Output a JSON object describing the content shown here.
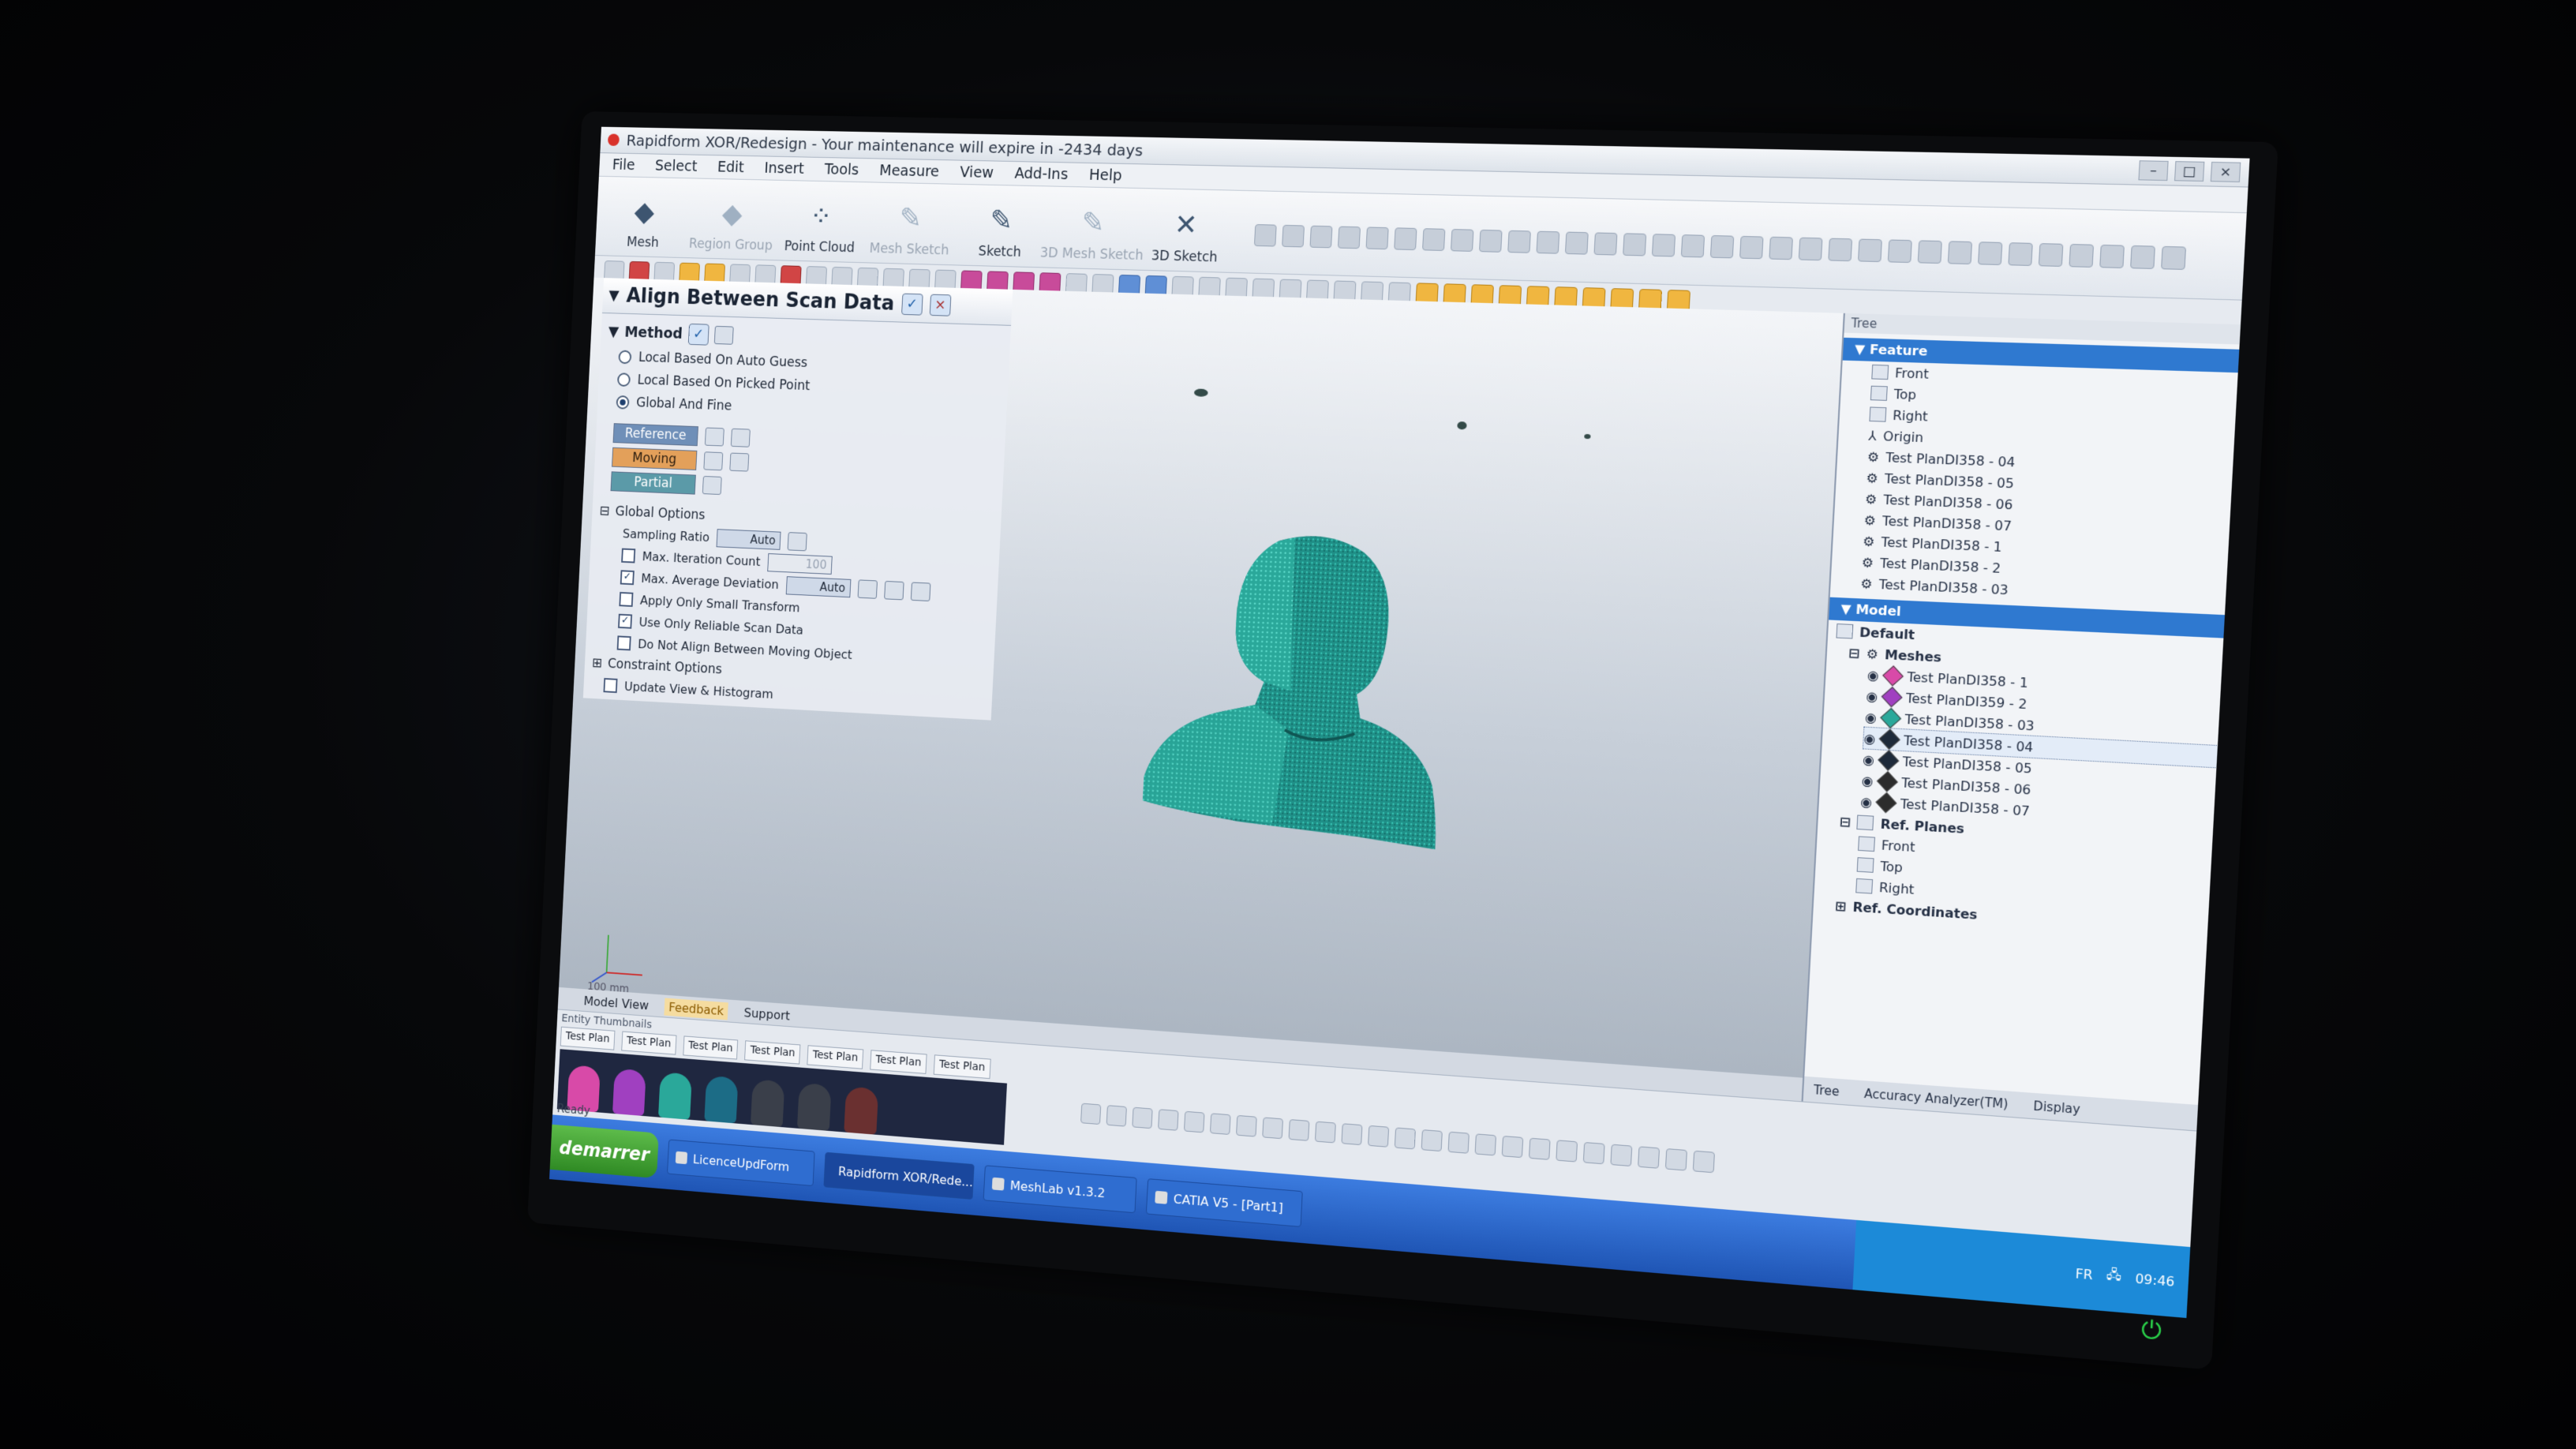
{
  "window": {
    "title": "Rapidform XOR/Redesign - Your maintenance will expire in -2434 days"
  },
  "menu": [
    "File",
    "Select",
    "Edit",
    "Insert",
    "Tools",
    "Measure",
    "View",
    "Add-Ins",
    "Help"
  ],
  "ribbon": [
    {
      "label": "Mesh",
      "icon": "mesh-icon",
      "dim": false
    },
    {
      "label": "Region Group",
      "icon": "region-group-icon",
      "dim": true
    },
    {
      "label": "Point Cloud",
      "icon": "point-cloud-icon",
      "dim": false
    },
    {
      "label": "Mesh Sketch",
      "icon": "mesh-sketch-icon",
      "dim": true
    },
    {
      "label": "Sketch",
      "icon": "sketch-icon",
      "dim": false
    },
    {
      "label": "3D Mesh Sketch",
      "icon": "3d-mesh-sketch-icon",
      "dim": true
    },
    {
      "label": "3D Sketch",
      "icon": "3d-sketch-icon",
      "dim": false
    }
  ],
  "panel": {
    "title": "Align Between Scan Data",
    "method_label": "Method",
    "methods": [
      {
        "label": "Local Based On Auto Guess",
        "selected": false
      },
      {
        "label": "Local Based On Picked Point",
        "selected": false
      },
      {
        "label": "Global And Fine",
        "selected": true
      }
    ],
    "roles": {
      "reference": "Reference",
      "moving": "Moving",
      "partial": "Partial"
    },
    "global_options_label": "Global Options",
    "sampling_ratio_label": "Sampling Ratio",
    "sampling_ratio_value": "Auto",
    "max_iteration_label": "Max. Iteration Count",
    "max_iteration_value": "100",
    "max_iteration_checked": false,
    "max_avg_dev_label": "Max. Average Deviation",
    "max_avg_dev_value": "Auto",
    "max_avg_dev_checked": true,
    "apply_small_label": "Apply Only Small Transform",
    "apply_small_checked": false,
    "use_reliable_label": "Use Only Reliable Scan Data",
    "use_reliable_checked": true,
    "no_align_moving_label": "Do Not Align Between Moving Object",
    "no_align_moving_checked": false,
    "constraint_label": "Constraint Options",
    "update_view_label": "Update View & Histogram",
    "update_view_checked": false
  },
  "viewport": {
    "scale_label": "100 mm"
  },
  "view_tabs": {
    "model_view": "Model View",
    "feedback": "Feedback",
    "support": "Support"
  },
  "tree": {
    "title": "Tree",
    "feature_header": "Feature",
    "feature_items": [
      "Front",
      "Top",
      "Right",
      "Origin",
      "Test PlanDI358 - 04",
      "Test PlanDI358 - 05",
      "Test PlanDI358 - 06",
      "Test PlanDI358 - 07",
      "Test PlanDI358 - 1",
      "Test PlanDI358 - 2",
      "Test PlanDI358 - 03"
    ],
    "model_header": "Model",
    "default_label": "Default",
    "meshes_label": "Meshes",
    "meshes": [
      {
        "label": "Test PlanDI358 - 1",
        "color": "#d84aa8"
      },
      {
        "label": "Test PlanDI359 - 2",
        "color": "#a040c0"
      },
      {
        "label": "Test PlanDI358 - 03",
        "color": "#2aa89a"
      },
      {
        "label": "Test PlanDI358 - 04",
        "color": "#1e2a3a"
      },
      {
        "label": "Test PlanDI358 - 05",
        "color": "#1e2a3a"
      },
      {
        "label": "Test PlanDI358 - 06",
        "color": "#2c2c2c"
      },
      {
        "label": "Test PlanDI358 - 07",
        "color": "#2c2c2c"
      }
    ],
    "selected_mesh": "Test PlanDI358 - 04",
    "ref_planes_label": "Ref. Planes",
    "ref_planes": [
      "Front",
      "Top",
      "Right"
    ],
    "ref_coord_label": "Ref. Coordinates",
    "footer_tabs": [
      "Tree",
      "Accuracy Analyzer(TM)",
      "Display"
    ]
  },
  "bottom": {
    "entity_thumbnails": "Entity Thumbnails",
    "thumb_tabs": [
      "Test Plan",
      "Test Plan",
      "Test Plan",
      "Test Plan",
      "Test Plan",
      "Test Plan",
      "Test Plan"
    ],
    "status": "Ready"
  },
  "taskbar": {
    "start": "demarrer",
    "tasks": [
      "LicenceUpdForm",
      "Rapidform XOR/Rede...",
      "MeshLab v1.3.2",
      "CATIA V5 - [Part1]"
    ],
    "language": "FR",
    "clock": "09:46"
  }
}
